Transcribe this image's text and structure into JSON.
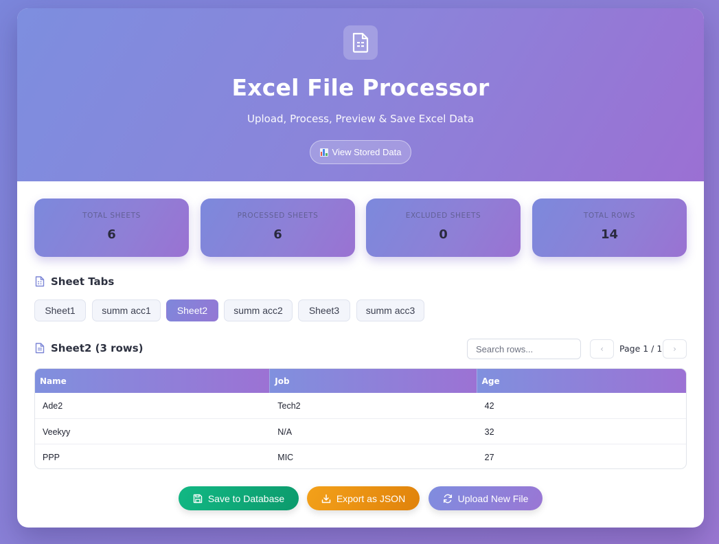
{
  "header": {
    "title": "Excel File Processor",
    "subtitle": "Upload, Process, Preview & Save Excel Data",
    "view_button": "View Stored Data",
    "icon": "spreadsheet-file-icon"
  },
  "stats": [
    {
      "label": "TOTAL SHEETS",
      "value": "6"
    },
    {
      "label": "PROCESSED SHEETS",
      "value": "6"
    },
    {
      "label": "EXCLUDED SHEETS",
      "value": "0"
    },
    {
      "label": "TOTAL ROWS",
      "value": "14"
    }
  ],
  "sheet_tabs": {
    "heading": "Sheet Tabs",
    "tabs": [
      "Sheet1",
      "summ acc1",
      "Sheet2",
      "summ acc2",
      "Sheet3",
      "summ acc3"
    ],
    "active_index": 2
  },
  "table_section": {
    "heading": "Sheet2 (3 rows)",
    "search_placeholder": "Search rows...",
    "page_label": "Page 1 / 1",
    "prev_icon": "chevron-left-icon",
    "next_icon": "chevron-right-icon"
  },
  "table": {
    "columns": [
      "Name",
      "Job",
      "Age"
    ],
    "rows": [
      [
        "Ade2",
        "Tech2",
        "42"
      ],
      [
        "Veekyy",
        "N/A",
        "32"
      ],
      [
        "PPP",
        "MIC",
        "27"
      ]
    ]
  },
  "actions": {
    "save": "Save to Database",
    "export": "Export as JSON",
    "upload": "Upload New File"
  },
  "colors": {
    "accent_purple": "#8b7fd8",
    "save_green": "#10a97a",
    "export_orange": "#ef9a12",
    "upload_purple": "#8b80dc"
  }
}
